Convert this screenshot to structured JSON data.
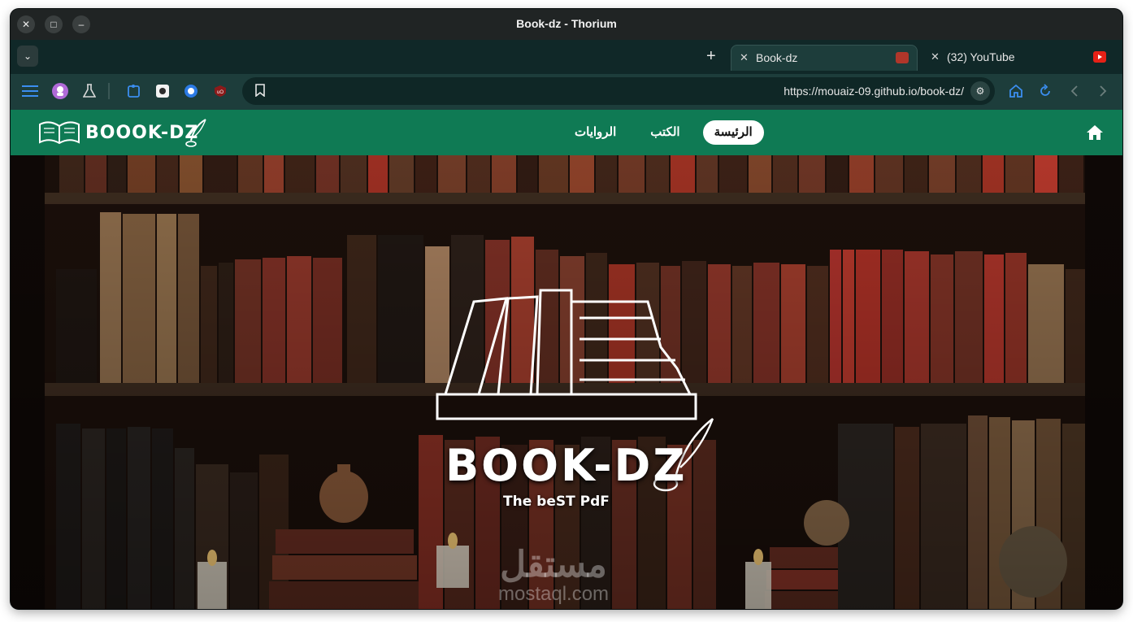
{
  "window": {
    "title": "Book-dz - Thorium"
  },
  "window_controls": {
    "close": "✕",
    "maximize": "□",
    "minimize": "–"
  },
  "tabs": [
    {
      "label": "Book-dz",
      "active": true
    },
    {
      "label": "(32) YouTube",
      "active": false
    }
  ],
  "toolbar": {
    "url": "https://mouaiz-09.github.io/book-dz/"
  },
  "site": {
    "logo_text": "BOOOK-DZ",
    "nav": [
      {
        "label": "الرئيسة",
        "active": true
      },
      {
        "label": "الكتب",
        "active": false
      },
      {
        "label": "الروايات",
        "active": false
      }
    ],
    "hero_title": "BOOK-DZ",
    "hero_subtitle": "The beST PdF",
    "watermark_ar": "مستقل",
    "watermark_en": "mostaql.com"
  },
  "colors": {
    "nav_green": "#0f7a54",
    "toolbar": "#1d3d3b",
    "tabstrip": "#102828",
    "icon_blue": "#3b8ef0"
  }
}
